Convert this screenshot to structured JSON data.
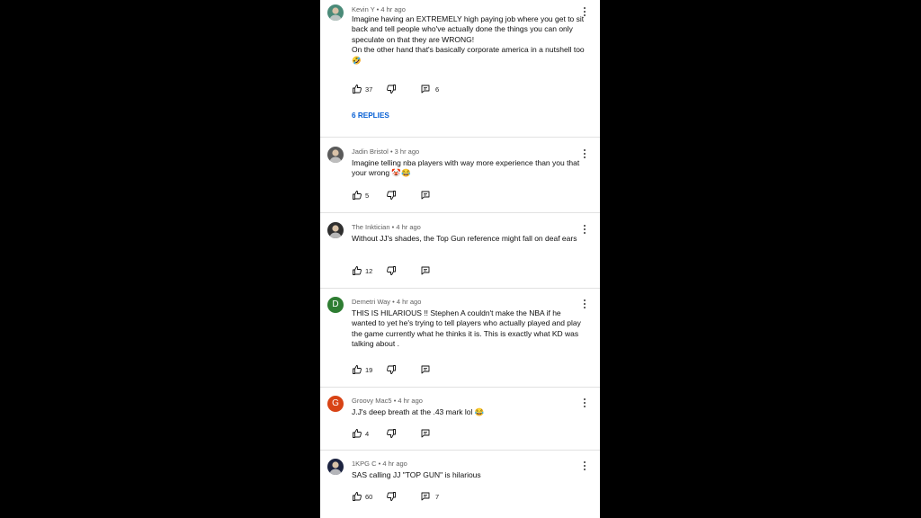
{
  "comments": [
    {
      "author": "Kevin Y",
      "time": "4 hr ago",
      "text": "Imagine having an EXTREMELY high paying job where you get to sit back and tell people who've actually done the things you can only speculate on that they are WRONG!\nOn the other hand that's basically corporate america in a nutshell too🤣",
      "likes": "37",
      "replies": "6",
      "view_replies": "6 REPLIES",
      "avatar_color": "#4a8a78"
    },
    {
      "author": "Jadin Bristol",
      "time": "3 hr ago",
      "text": "Imagine telling nba players with way more experience than you that your wrong 🤡😂",
      "likes": "5",
      "avatar_color": "#5a5a5a"
    },
    {
      "author": "The Inktician",
      "time": "4 hr ago",
      "text": "Without JJ's shades, the Top Gun reference might fall on deaf ears",
      "likes": "12",
      "avatar_color": "#2f2f2f"
    },
    {
      "author": "Demetri Way",
      "time": "4 hr ago",
      "text": "THIS IS HILARIOUS !! Stephen A couldn't make the NBA if he wanted to yet he's trying to tell players who actually played and play the game currently what he thinks it is. This is exactly what KD was talking about .",
      "likes": "19",
      "avatar_letter": "D",
      "avatar_color": "#2e7d32"
    },
    {
      "author": "Groovy Mac5",
      "time": "4 hr ago",
      "text": "J.J's deep breath at the .43 mark lol 😂",
      "likes": "4",
      "avatar_letter": "G",
      "avatar_color": "#d84315"
    },
    {
      "author": "1KPG C",
      "time": "4 hr ago",
      "text": "SAS calling JJ \"TOP GUN\" is hilarious",
      "likes": "60",
      "replies": "7",
      "avatar_color": "#1c2340"
    }
  ],
  "icons": {
    "like": "thumbs-up-icon",
    "dislike": "thumbs-down-icon",
    "reply": "reply-icon",
    "menu": "more-vert-icon"
  }
}
